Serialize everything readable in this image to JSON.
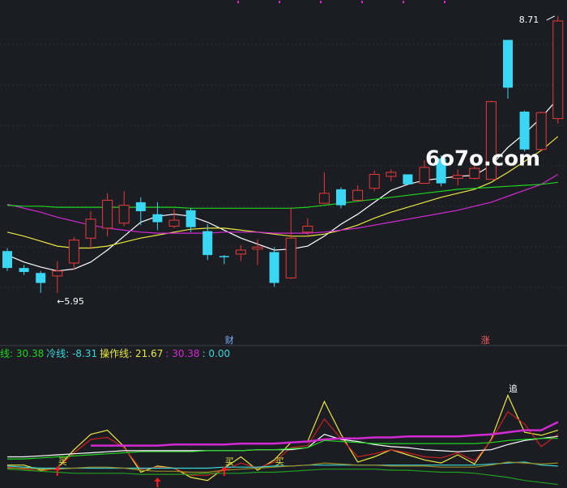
{
  "chart_data": [
    {
      "type": "candlestick",
      "ylim": [
        5.6,
        8.85
      ],
      "grid": true,
      "annotations": {
        "low_label": "5.95",
        "high_label": "8.71",
        "event_label_1": "财",
        "event_label_2": "涨"
      },
      "watermark": "6o7o.com",
      "candles": [
        {
          "open": 6.37,
          "close": 6.2,
          "high": 6.4,
          "low": 6.17
        },
        {
          "open": 6.2,
          "close": 6.16,
          "high": 6.23,
          "low": 6.13
        },
        {
          "open": 6.15,
          "close": 6.05,
          "high": 6.17,
          "low": 5.95
        },
        {
          "open": 6.12,
          "close": 6.17,
          "high": 6.27,
          "low": 5.95
        },
        {
          "open": 6.25,
          "close": 6.48,
          "high": 6.51,
          "low": 6.18
        },
        {
          "open": 6.5,
          "close": 6.69,
          "high": 6.77,
          "low": 6.39
        },
        {
          "open": 6.6,
          "close": 6.88,
          "high": 6.95,
          "low": 6.52
        },
        {
          "open": 6.65,
          "close": 6.83,
          "high": 6.97,
          "low": 6.62
        },
        {
          "open": 6.86,
          "close": 6.77,
          "high": 6.91,
          "low": 6.63
        },
        {
          "open": 6.74,
          "close": 6.66,
          "high": 6.86,
          "low": 6.58
        },
        {
          "open": 6.62,
          "close": 6.68,
          "high": 6.79,
          "low": 6.6
        },
        {
          "open": 6.78,
          "close": 6.61,
          "high": 6.8,
          "low": 6.56
        },
        {
          "open": 6.57,
          "close": 6.33,
          "high": 6.64,
          "low": 6.28
        },
        {
          "open": 6.32,
          "close": 6.31,
          "high": 6.33,
          "low": 6.24
        },
        {
          "open": 6.34,
          "close": 6.38,
          "high": 6.43,
          "low": 6.27
        },
        {
          "open": 6.39,
          "close": 6.41,
          "high": 6.49,
          "low": 6.23
        },
        {
          "open": 6.36,
          "close": 6.05,
          "high": 6.41,
          "low": 6.01
        },
        {
          "open": 6.1,
          "close": 6.5,
          "high": 6.81,
          "low": 6.09
        },
        {
          "open": 6.56,
          "close": 6.62,
          "high": 6.7,
          "low": 6.52
        },
        {
          "open": 6.85,
          "close": 6.95,
          "high": 7.16,
          "low": 6.85
        },
        {
          "open": 6.99,
          "close": 6.83,
          "high": 7.01,
          "low": 6.8
        },
        {
          "open": 6.88,
          "close": 6.98,
          "high": 7.03,
          "low": 6.87
        },
        {
          "open": 7.0,
          "close": 7.14,
          "high": 7.18,
          "low": 6.97
        },
        {
          "open": 7.12,
          "close": 7.16,
          "high": 7.19,
          "low": 7.07
        },
        {
          "open": 7.14,
          "close": 7.04,
          "high": 7.14,
          "low": 7.04
        },
        {
          "open": 7.05,
          "close": 7.21,
          "high": 7.28,
          "low": 7.05
        },
        {
          "open": 7.3,
          "close": 7.05,
          "high": 7.33,
          "low": 7.02
        },
        {
          "open": 7.1,
          "close": 7.13,
          "high": 7.19,
          "low": 7.03
        },
        {
          "open": 7.1,
          "close": 7.2,
          "high": 7.25,
          "low": 7.09
        },
        {
          "open": 7.09,
          "close": 7.87,
          "high": 7.88,
          "low": 7.09
        },
        {
          "open": 8.49,
          "close": 8.01,
          "high": 8.49,
          "low": 7.9
        },
        {
          "open": 7.77,
          "close": 7.39,
          "high": 7.78,
          "low": 7.37
        },
        {
          "open": 7.39,
          "close": 7.76,
          "high": 7.77,
          "low": 7.37
        },
        {
          "open": 7.7,
          "close": 8.68,
          "high": 8.73,
          "low": 7.65
        }
      ],
      "series": [
        {
          "color": "#ffffff",
          "values": [
            6.33,
            6.26,
            6.21,
            6.17,
            6.19,
            6.26,
            6.38,
            6.52,
            6.66,
            6.72,
            6.74,
            6.72,
            6.66,
            6.58,
            6.5,
            6.44,
            6.38,
            6.39,
            6.42,
            6.52,
            6.64,
            6.74,
            6.86,
            6.98,
            7.04,
            7.08,
            7.1,
            7.12,
            7.13,
            7.23,
            7.41,
            7.55,
            7.71,
            7.9
          ]
        },
        {
          "color": "#e8e841",
          "values": [
            6.56,
            6.52,
            6.47,
            6.42,
            6.4,
            6.4,
            6.42,
            6.46,
            6.5,
            6.53,
            6.56,
            6.59,
            6.6,
            6.6,
            6.58,
            6.56,
            6.54,
            6.52,
            6.52,
            6.54,
            6.58,
            6.63,
            6.7,
            6.76,
            6.81,
            6.86,
            6.91,
            6.95,
            6.99,
            7.06,
            7.16,
            7.27,
            7.38,
            7.52
          ]
        },
        {
          "color": "#d42ad4",
          "values": [
            6.84,
            6.8,
            6.76,
            6.71,
            6.67,
            6.63,
            6.6,
            6.58,
            6.56,
            6.55,
            6.55,
            6.55,
            6.55,
            6.56,
            6.56,
            6.56,
            6.55,
            6.55,
            6.55,
            6.56,
            6.58,
            6.6,
            6.63,
            6.66,
            6.69,
            6.72,
            6.75,
            6.78,
            6.82,
            6.86,
            6.92,
            6.98,
            7.04,
            7.14
          ]
        },
        {
          "color": "#1fd41f",
          "values": [
            6.83,
            6.82,
            6.82,
            6.81,
            6.81,
            6.81,
            6.81,
            6.81,
            6.81,
            6.81,
            6.81,
            6.8,
            6.8,
            6.8,
            6.8,
            6.8,
            6.8,
            6.8,
            6.81,
            6.83,
            6.85,
            6.87,
            6.89,
            6.91,
            6.93,
            6.95,
            6.97,
            6.99,
            7.0,
            7.01,
            7.02,
            7.03,
            7.04,
            7.06
          ]
        }
      ]
    },
    {
      "type": "line",
      "ylim": [
        -20,
        100
      ],
      "legend": [
        {
          "text": "线: 30.38",
          "color": "#1fd41f"
        },
        {
          "text": "冷线: -8.31",
          "color": "#3ad7d9"
        },
        {
          "text": "操作线: 21.67",
          "color": "#e8e841"
        },
        {
          "text": ": 30.38",
          "color": "#d42ad4"
        },
        {
          "text": ": 0.00",
          "color": "#3ad7d9"
        }
      ],
      "annotations": {
        "buy_label": "买",
        "chase_label": "追"
      },
      "buy_markers": [
        3,
        13,
        16
      ],
      "chase_marker": 30,
      "up_arrows": [
        3,
        9,
        13
      ],
      "series": [
        {
          "color": "#e8e841",
          "values": [
            0,
            0,
            -5,
            -3,
            15,
            30,
            34,
            18,
            -7,
            -1,
            -3,
            -12,
            -15,
            -3,
            8,
            -5,
            5,
            22,
            23,
            62,
            30,
            3,
            8,
            15,
            10,
            5,
            2,
            10,
            1,
            25,
            68,
            32,
            29,
            34
          ]
        },
        {
          "color": "#cc2020",
          "values": [
            -2,
            -4,
            -6,
            -3,
            12,
            25,
            27,
            17,
            -4,
            -2,
            -3,
            -10,
            -10,
            -5,
            2,
            -3,
            3,
            17,
            19,
            45,
            26,
            8,
            11,
            15,
            12,
            8,
            7,
            12,
            4,
            24,
            52,
            40,
            18,
            30
          ]
        },
        {
          "color": "#ffffff",
          "values": [
            8,
            8,
            9,
            10,
            11,
            12,
            13,
            14,
            14,
            14,
            14,
            14,
            14,
            14,
            14,
            15,
            15,
            15,
            17,
            30,
            25,
            23,
            20,
            18,
            17,
            15,
            14,
            13,
            14,
            15,
            20,
            24,
            26,
            28
          ]
        },
        {
          "color": "#d42ad4",
          "values": [
            null,
            null,
            null,
            null,
            null,
            19,
            19,
            19,
            19,
            19,
            20,
            20,
            20,
            20,
            21,
            21,
            21,
            22,
            23,
            25,
            26,
            26,
            27,
            27,
            28,
            28,
            28,
            28,
            29,
            30,
            32,
            34,
            34,
            42
          ]
        },
        {
          "color": "#1fd41f",
          "values": [
            6,
            6,
            7,
            8,
            9,
            10,
            11,
            12,
            13,
            13,
            13,
            13,
            14,
            14,
            14,
            15,
            15,
            16,
            17,
            24,
            23,
            22,
            21,
            21,
            21,
            21,
            21,
            21,
            21,
            22,
            24,
            25,
            26,
            26
          ]
        },
        {
          "color": "#3ad7d9",
          "values": [
            -1,
            -2,
            -3,
            -3,
            -3,
            -3,
            -3,
            -3,
            -3,
            -3,
            -3,
            -3,
            -3,
            -2,
            -2,
            -2,
            -1,
            -1,
            0,
            0,
            0,
            0,
            0,
            0,
            0,
            0,
            0,
            0,
            0,
            1,
            2,
            3,
            0,
            -1
          ]
        },
        {
          "color": "#1fa01f",
          "values": [
            -4,
            -5,
            -6,
            -7,
            -8,
            -8,
            -8,
            -8,
            -9,
            -9,
            -9,
            -9,
            -8,
            -8,
            -8,
            -7,
            -7,
            -6,
            -5,
            -4,
            -4,
            -4,
            -4,
            -5,
            -5,
            -6,
            -7,
            -7,
            -8,
            -10,
            -12,
            -15,
            -17,
            -19
          ]
        },
        {
          "color": "#9a8a20",
          "values": [
            -3,
            -3,
            -4,
            -4,
            -3,
            -2,
            -2,
            -3,
            -5,
            -6,
            -6,
            -7,
            -7,
            -5,
            -4,
            -3,
            -2,
            -1,
            0,
            2,
            1,
            0,
            0,
            -1,
            -1,
            -1,
            -2,
            -2,
            -2,
            0,
            3,
            2,
            1,
            2
          ]
        }
      ]
    }
  ]
}
